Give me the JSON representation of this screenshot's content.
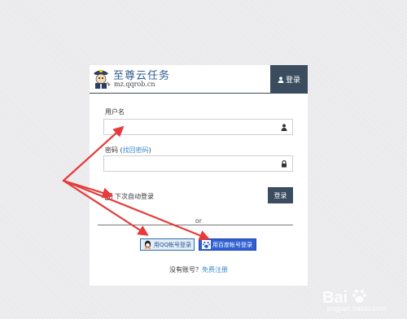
{
  "brand": {
    "title": "至尊云任务",
    "subtitle": "mz.qqrob.cn",
    "logo_icon": "police-mascot-icon"
  },
  "header": {
    "login_tab_label": "登录",
    "login_tab_icon": "user-icon"
  },
  "form": {
    "username_label": "用户名",
    "username_value": "",
    "username_icon": "user-icon",
    "password_label": "密码",
    "password_link_open": "(",
    "password_link": "找回密码",
    "password_link_close": ")",
    "password_value": "",
    "password_icon": "lock-icon",
    "remember_label": "下次自动登录",
    "remember_checked": true,
    "submit_label": "登录"
  },
  "divider": {
    "or_text": "or"
  },
  "oauth": {
    "qq_label": "用QQ帐号登录",
    "baidu_label": "用百度帐号登录"
  },
  "register": {
    "prompt": "没有账号？",
    "link": "免费注册"
  },
  "watermark": {
    "text": "jingyan.baidu.com"
  },
  "colors": {
    "accent_dark": "#3b4c5f",
    "link": "#3b8bd0",
    "brand_blue": "#2e5c8f",
    "annotation_arrow": "#e83a3a",
    "baidu_blue": "#2f5fd3"
  }
}
